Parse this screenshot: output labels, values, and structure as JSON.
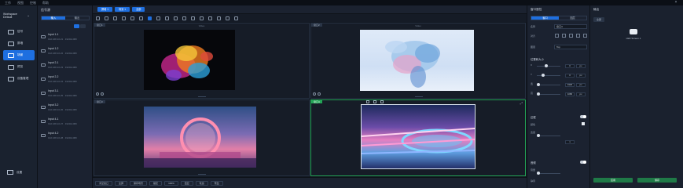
{
  "menubar": {
    "items": [
      "工作",
      "视图",
      "控制",
      "帮助"
    ]
  },
  "nav": {
    "workspace": "Workspace Default",
    "items": [
      {
        "label": "信号",
        "icon": "monitor-icon"
      },
      {
        "label": "屏墙",
        "icon": "wall-icon"
      },
      {
        "label": "场景",
        "icon": "scene-icon",
        "active": true
      },
      {
        "label": "预览",
        "icon": "preview-icon"
      },
      {
        "label": "设备管理",
        "icon": "device-icon"
      }
    ],
    "bottom_label": "设置"
  },
  "sources": {
    "title": "信号源",
    "tabs": [
      "输入",
      "输出"
    ],
    "items": [
      {
        "name": "Input 1-1",
        "sub": "192.168.10.21 · 1920x1080"
      },
      {
        "name": "Input 1-2",
        "sub": "192.168.10.22 · 1920x1080"
      },
      {
        "name": "Input 2-1",
        "sub": "192.168.10.23 · 1920x1080"
      },
      {
        "name": "Input 2-2",
        "sub": "192.168.10.24 · 1920x1080"
      },
      {
        "name": "Input 3-1",
        "sub": "192.168.10.25 · 1920x1080"
      },
      {
        "name": "Input 3-2",
        "sub": "192.168.10.26 · 1920x1080"
      },
      {
        "name": "Input 4-1",
        "sub": "192.168.10.27 · 1920x1080"
      },
      {
        "name": "Input 4-2",
        "sub": "192.168.10.28 · 1920x1080"
      }
    ]
  },
  "toolbar": {
    "btn1": "屏墙 1",
    "btn2": "场景 1",
    "btn3": "全部"
  },
  "canvas": {
    "cells": [
      {
        "tag": "窗口1",
        "name": "Video"
      },
      {
        "tag": "窗口2",
        "name": "Video"
      },
      {
        "tag": "窗口3",
        "name": ""
      },
      {
        "tag": "窗口4",
        "name": ""
      }
    ]
  },
  "bottombar": {
    "buttons": [
      "清空窗口",
      "全屏",
      "保存场景",
      "锁定",
      "100%",
      "回显",
      "轮巡",
      "预监"
    ]
  },
  "props": {
    "title": "窗口属性",
    "tabs": [
      "窗口",
      "图层"
    ],
    "name_key": "名称",
    "name_val": "窗口4",
    "align_key": "对齐",
    "layer_key": "图层",
    "layer_val": "Top",
    "size_title": "位置和大小",
    "x_label": "X",
    "y_label": "Y",
    "w_label": "宽",
    "h_label": "高",
    "x_val": "0",
    "y_val": "0",
    "w_val": "1920",
    "h_val": "1080",
    "border_title": "边框",
    "border_color": "颜色",
    "border_width": "宽度",
    "audio_title": "音频",
    "volume_key": "音量",
    "mute_key": "静音"
  },
  "rpanel": {
    "title": "输出",
    "chip": "全部",
    "device_caption": "LED Screen 1",
    "action1": "应用",
    "action2": "保存"
  },
  "colors": {
    "accent": "#1e6fe0",
    "selected": "#23a456",
    "bg": "#1b2230"
  }
}
